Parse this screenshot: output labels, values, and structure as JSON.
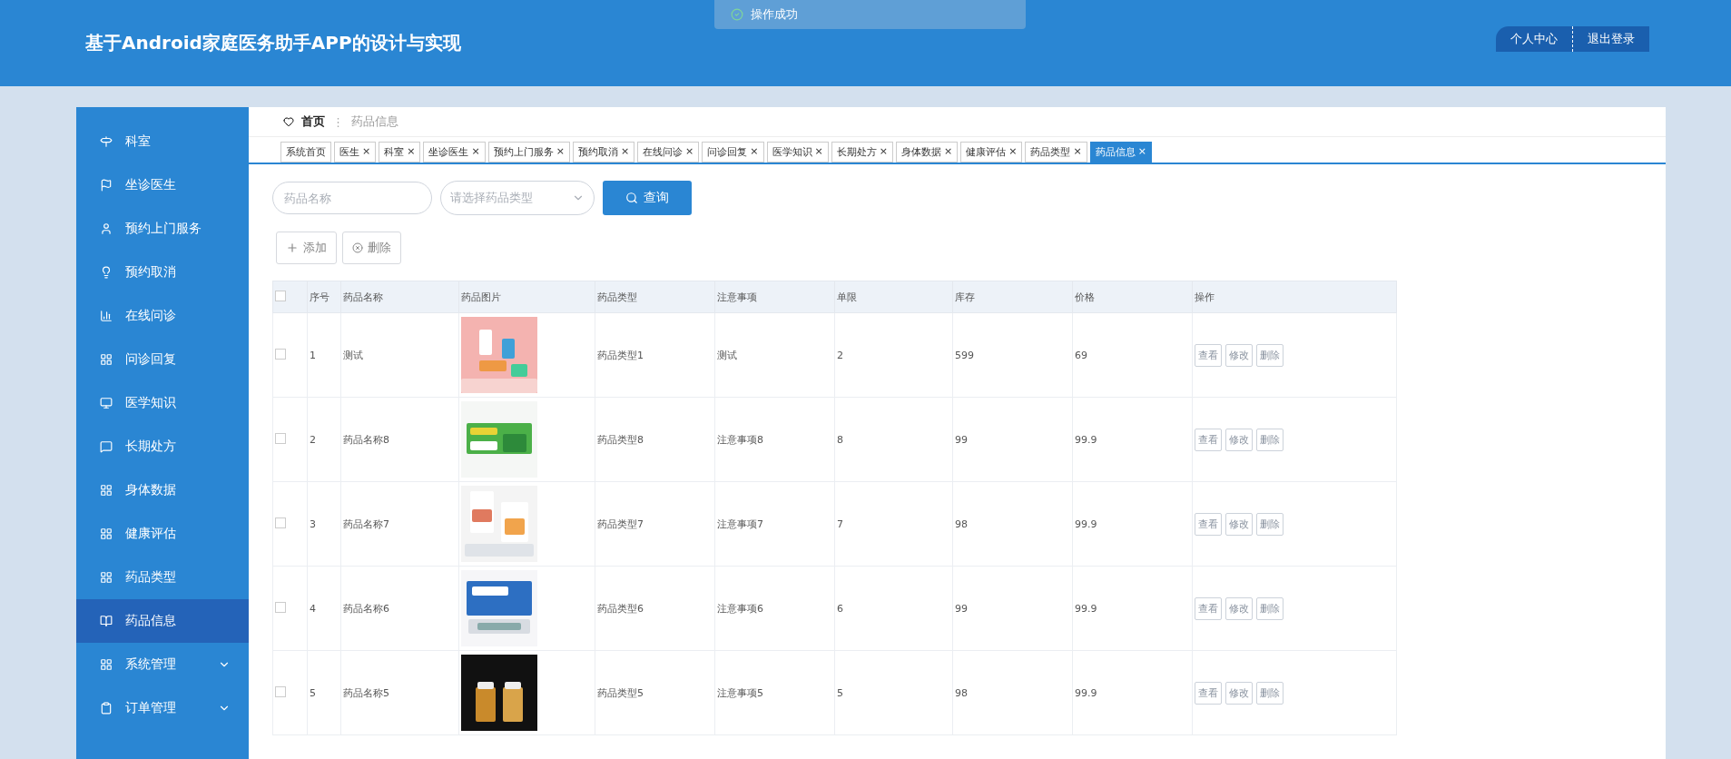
{
  "header": {
    "title": "基于Android家庭医务助手APP的设计与实现",
    "buttons": [
      "个人中心",
      "退出登录"
    ]
  },
  "toast": {
    "text": "操作成功"
  },
  "sidebar": {
    "items": [
      {
        "label": "科室",
        "selected": false,
        "expandable": false
      },
      {
        "label": "坐诊医生",
        "selected": false,
        "expandable": false
      },
      {
        "label": "预约上门服务",
        "selected": false,
        "expandable": false
      },
      {
        "label": "预约取消",
        "selected": false,
        "expandable": false
      },
      {
        "label": "在线问诊",
        "selected": false,
        "expandable": false
      },
      {
        "label": "问诊回复",
        "selected": false,
        "expandable": false
      },
      {
        "label": "医学知识",
        "selected": false,
        "expandable": false
      },
      {
        "label": "长期处方",
        "selected": false,
        "expandable": false
      },
      {
        "label": "身体数据",
        "selected": false,
        "expandable": false
      },
      {
        "label": "健康评估",
        "selected": false,
        "expandable": false
      },
      {
        "label": "药品类型",
        "selected": false,
        "expandable": false
      },
      {
        "label": "药品信息",
        "selected": true,
        "expandable": false
      },
      {
        "label": "系统管理",
        "selected": false,
        "expandable": true
      },
      {
        "label": "订单管理",
        "selected": false,
        "expandable": true
      }
    ]
  },
  "breadcrumb": {
    "home": "首页",
    "separator": "⋮",
    "current": "药品信息"
  },
  "tabs": [
    {
      "label": "系统首页",
      "selected": false
    },
    {
      "label": "医生",
      "close": "×",
      "selected": false
    },
    {
      "label": "科室",
      "close": "×",
      "selected": false
    },
    {
      "label": "坐诊医生",
      "close": "×",
      "selected": false
    },
    {
      "label": "预约上门服务",
      "close": "×",
      "selected": false
    },
    {
      "label": "预约取消",
      "close": "×",
      "selected": false
    },
    {
      "label": "在线问诊",
      "close": "×",
      "selected": false
    },
    {
      "label": "问诊回复",
      "close": "×",
      "selected": false
    },
    {
      "label": "医学知识",
      "close": "×",
      "selected": false
    },
    {
      "label": "长期处方",
      "close": "×",
      "selected": false
    },
    {
      "label": "身体数据",
      "close": "×",
      "selected": false
    },
    {
      "label": "健康评估",
      "close": "×",
      "selected": false
    },
    {
      "label": "药品类型",
      "close": "×",
      "selected": false
    },
    {
      "label": "药品信息",
      "close": "×",
      "selected": true
    }
  ],
  "search": {
    "name_placeholder": "药品名称",
    "type_placeholder": "请选择药品类型",
    "button": "查询"
  },
  "actions": [
    "添加",
    "删除"
  ],
  "table": {
    "header_checked": false,
    "columns": [
      "序号",
      "药品名称",
      "药品图片",
      "药品类型",
      "注意事项",
      "单限",
      "库存",
      "价格",
      "操作"
    ],
    "rows": [
      {
        "checked": false,
        "index": "1",
        "name": "测试",
        "type": "药品类型1",
        "notes": "测试",
        "limit": "2",
        "stock": "599",
        "price": "69",
        "buttons": [
          "查看",
          "修改",
          "删除"
        ]
      },
      {
        "checked": false,
        "index": "2",
        "name": "药品名称8",
        "type": "药品类型8",
        "notes": "注意事项8",
        "limit": "8",
        "stock": "99",
        "price": "99.9",
        "buttons": [
          "查看",
          "修改",
          "删除"
        ]
      },
      {
        "checked": false,
        "index": "3",
        "name": "药品名称7",
        "type": "药品类型7",
        "notes": "注意事项7",
        "limit": "7",
        "stock": "98",
        "price": "99.9",
        "buttons": [
          "查看",
          "修改",
          "删除"
        ]
      },
      {
        "checked": false,
        "index": "4",
        "name": "药品名称6",
        "type": "药品类型6",
        "notes": "注意事项6",
        "limit": "6",
        "stock": "99",
        "price": "99.9",
        "buttons": [
          "查看",
          "修改",
          "删除"
        ]
      },
      {
        "checked": false,
        "index": "5",
        "name": "药品名称5",
        "type": "药品类型5",
        "notes": "注意事项5",
        "limit": "5",
        "stock": "98",
        "price": "99.9",
        "buttons": [
          "查看",
          "修改",
          "删除"
        ]
      }
    ]
  }
}
